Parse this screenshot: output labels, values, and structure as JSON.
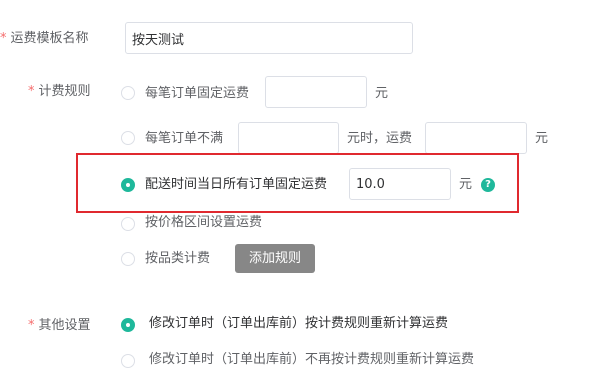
{
  "form": {
    "template_name_label": "运费模板名称",
    "template_name_value": "按天测试",
    "fee_rule_label": "计费规则",
    "other_label": "其他设置",
    "required_mark": "*"
  },
  "fee_rules": {
    "fixed_per_order": {
      "label": "每笔订单固定运费",
      "unit": "元",
      "value": ""
    },
    "below_threshold": {
      "label": "每笔订单不满",
      "mid_label": "元时，运费",
      "unit": "元",
      "value1": "",
      "value2": ""
    },
    "same_day_fixed": {
      "label": "配送时间当日所有订单固定运费",
      "value": "10.0",
      "unit": "元",
      "help": "?"
    },
    "price_range": {
      "label": "按价格区间设置运费"
    },
    "by_category": {
      "label": "按品类计费",
      "button": "添加规则"
    },
    "selected": "same_day_fixed"
  },
  "other_settings": {
    "option1": "修改订单时（订单出库前）按计费规则重新计算运费",
    "option2": "修改订单时（订单出库前）不再按计费规则重新计算运费",
    "selected": "option1"
  },
  "colors": {
    "accent": "#1fb89b",
    "highlight": "#e0292f",
    "button": "#878787",
    "required": "#f56c6c"
  }
}
